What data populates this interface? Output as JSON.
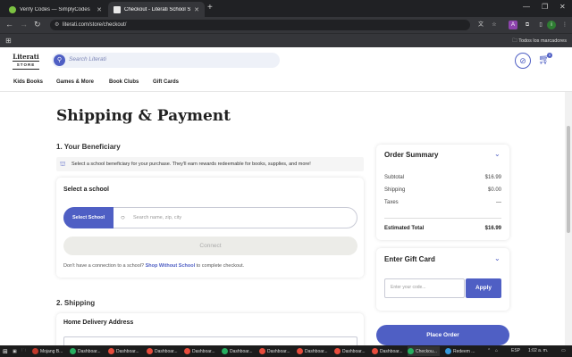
{
  "browser": {
    "tabs": [
      {
        "title": "Verify Codes — SimplyCodes",
        "active": false,
        "favicon_color": "#7cc242"
      },
      {
        "title": "Checkout - Literati School Store",
        "active": true,
        "favicon_color": "#e8e8e8"
      }
    ],
    "url": "literati.com/store/checkout/",
    "all_bookmarks_label": "Todos los marcadores",
    "profile_initial": "i"
  },
  "header": {
    "logo_main": "Literati",
    "logo_sub": "STORE",
    "search_placeholder": "Search Literati",
    "cart_count": "0"
  },
  "nav": {
    "items": [
      "Kids Books",
      "Games & More",
      "Book Clubs",
      "Gift Cards"
    ]
  },
  "page": {
    "title": "Shipping & Payment",
    "beneficiary": {
      "heading": "1.  Your Beneficiary",
      "info": "Select a school beneficiary for your purchase. They'll earn rewards redeemable for books, supplies, and more!",
      "select_school_heading": "Select a school",
      "select_button": "Select School",
      "search_placeholder": "Search name, zip, city",
      "connect_button": "Connect",
      "no_connection_prefix": "Don't have a connection to a school?",
      "no_connection_link": "Shop Without School",
      "no_connection_suffix": "to complete checkout."
    },
    "shipping": {
      "heading": "2.  Shipping",
      "home_delivery": "Home Delivery Address"
    }
  },
  "order_summary": {
    "title": "Order Summary",
    "rows": [
      {
        "label": "Subtotal",
        "value": "$16.99"
      },
      {
        "label": "Shipping",
        "value": "$0.00"
      },
      {
        "label": "Taxes",
        "value": "—"
      }
    ],
    "total_label": "Estimated Total",
    "total_value": "$16.99"
  },
  "gift_card": {
    "title": "Enter Gift Card",
    "placeholder": "Enter your code...",
    "apply_label": "Apply"
  },
  "place_order_label": "Place Order",
  "taskbar": {
    "items": [
      {
        "label": "Mojang B...",
        "color": "#c0392b"
      },
      {
        "label": "Dashboar...",
        "color": "#27ae60"
      },
      {
        "label": "Dashboar...",
        "color": "#e74c3c"
      },
      {
        "label": "Dashboar...",
        "color": "#e74c3c"
      },
      {
        "label": "Dashboar...",
        "color": "#e74c3c"
      },
      {
        "label": "Dashboar...",
        "color": "#27ae60"
      },
      {
        "label": "Dashboar...",
        "color": "#e74c3c"
      },
      {
        "label": "Dashboar...",
        "color": "#e74c3c"
      },
      {
        "label": "Dashboar...",
        "color": "#e74c3c"
      },
      {
        "label": "Dashboar...",
        "color": "#e74c3c"
      },
      {
        "label": "Checkou...",
        "color": "#27ae60"
      },
      {
        "label": "Redeem ...",
        "color": "#3498db"
      }
    ],
    "language": "ESP",
    "time": "1:02 a. m."
  },
  "colors": {
    "accent": "#4f5fc4",
    "chrome_dark": "#202124",
    "chrome_mid": "#35363a"
  }
}
